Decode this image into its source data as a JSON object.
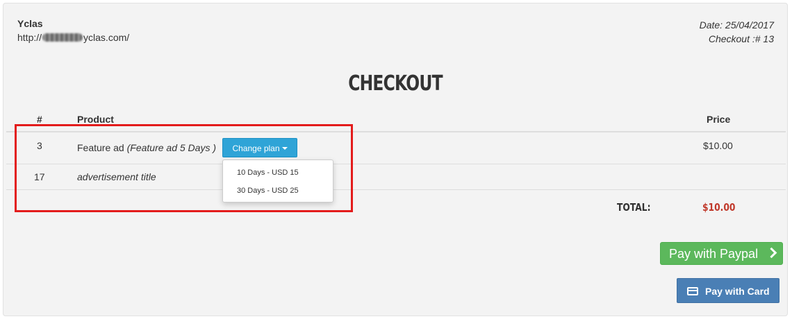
{
  "seller": {
    "name": "Yclas",
    "url_prefix": "http://",
    "url_suffix": "yclas.com/"
  },
  "meta": {
    "date": "Date: 25/04/2017",
    "checkout": "Checkout :# 13"
  },
  "page_title": "CHECKOUT",
  "table": {
    "headers": {
      "num": "#",
      "product": "Product",
      "price": "Price"
    },
    "rows": [
      {
        "num": "3",
        "product": "Feature ad",
        "plan": "(Feature ad 5 Days )",
        "price": "$10.00"
      },
      {
        "num": "17",
        "product": "advertisement title",
        "price": ""
      }
    ]
  },
  "change_plan": {
    "label": "Change plan",
    "options": [
      "10 Days - USD 15",
      "30 Days - USD 25"
    ]
  },
  "total": {
    "label": "TOTAL:",
    "value": "$10.00"
  },
  "buttons": {
    "paypal": "Pay with Paypal",
    "card": "Pay with Card"
  },
  "colors": {
    "primary": "#2fa4d7",
    "success": "#5cb85c",
    "card": "#4a7fb5",
    "total": "#c0392b",
    "highlight": "#e31b1b"
  }
}
